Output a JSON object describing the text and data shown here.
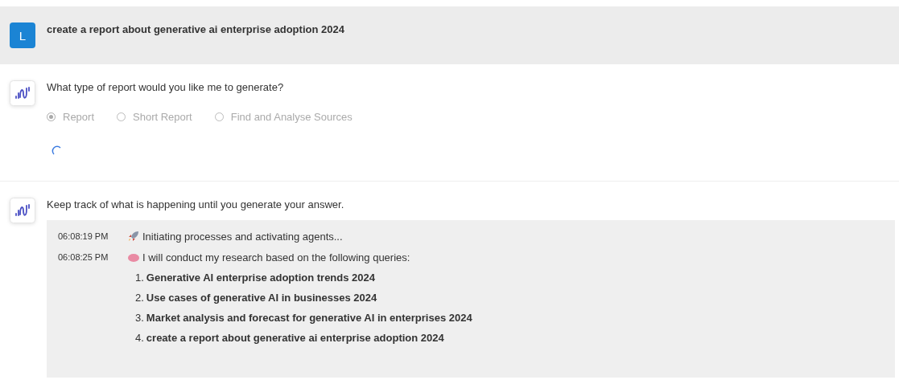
{
  "user_message": {
    "avatar": "L",
    "text": "create a report about generative ai enterprise adoption 2024"
  },
  "messages": [
    {
      "kind": "choice",
      "text": "What type of report would you like me to generate?",
      "disabled": true,
      "loading": true,
      "options": [
        {
          "label": "Report",
          "selected": true
        },
        {
          "label": "Short Report",
          "selected": false
        },
        {
          "label": "Find and Analyse Sources",
          "selected": false
        }
      ]
    },
    {
      "kind": "log",
      "text": "Keep track of what is happening until you generate your answer.",
      "entries": [
        {
          "time": "06:08:19 PM",
          "kind": "status",
          "text": "Initiating processes and activating agents..."
        },
        {
          "time": "06:08:25 PM",
          "kind": "plan",
          "text": "I will conduct my research based on the following queries:",
          "items": [
            {
              "number": "1.",
              "text": "Generative AI enterprise adoption trends 2024"
            },
            {
              "number": "2.",
              "text": "Use cases of generative AI in businesses 2024"
            },
            {
              "number": "3.",
              "text": "Market analysis and forecast for generative AI in enterprises 2024"
            },
            {
              "number": "4.",
              "text": "create a report about generative ai enterprise adoption 2024"
            }
          ]
        }
      ]
    }
  ]
}
